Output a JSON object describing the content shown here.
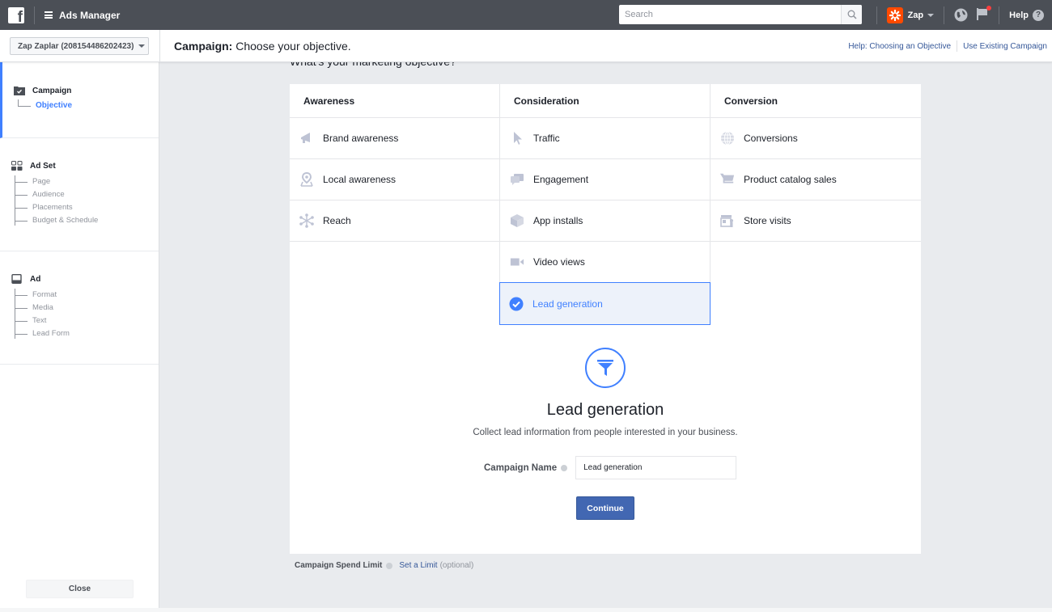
{
  "topbar": {
    "logo": "facebook-logo",
    "app_title": "Ads Manager",
    "search_placeholder": "Search",
    "search_value": "",
    "account_short": "Zap",
    "help_label": "Help",
    "help_glyph": "?",
    "notifications_badge_color": "#fa3e3e"
  },
  "subbar": {
    "account_selector": "Zap Zaplar (208154486202423)",
    "title_prefix": "Campaign:",
    "title_text": " Choose your objective.",
    "links": [
      "Help: Choosing an Objective",
      "Use Existing Campaign"
    ]
  },
  "sidebar": {
    "sections": [
      {
        "label": "Campaign",
        "icon": "folder-check-icon",
        "items": [
          {
            "label": "Objective",
            "active": true
          }
        ]
      },
      {
        "label": "Ad Set",
        "icon": "grid-icon",
        "items": [
          {
            "label": "Page"
          },
          {
            "label": "Audience"
          },
          {
            "label": "Placements"
          },
          {
            "label": "Budget & Schedule"
          }
        ]
      },
      {
        "label": "Ad",
        "icon": "ad-frame-icon",
        "items": [
          {
            "label": "Format"
          },
          {
            "label": "Media"
          },
          {
            "label": "Text"
          },
          {
            "label": "Lead Form"
          }
        ]
      }
    ],
    "close_label": "Close"
  },
  "main": {
    "heading": "What's your marketing objective?",
    "columns": [
      {
        "title": "Awareness",
        "items": [
          {
            "label": "Brand awareness",
            "icon": "megaphone-icon"
          },
          {
            "label": "Local awareness",
            "icon": "location-pin-icon"
          },
          {
            "label": "Reach",
            "icon": "reach-network-icon"
          }
        ]
      },
      {
        "title": "Consideration",
        "items": [
          {
            "label": "Traffic",
            "icon": "cursor-icon"
          },
          {
            "label": "Engagement",
            "icon": "chat-bubbles-icon"
          },
          {
            "label": "App installs",
            "icon": "box-icon"
          },
          {
            "label": "Video views",
            "icon": "video-camera-icon"
          },
          {
            "label": "Lead generation",
            "icon": "check-circle-icon",
            "selected": true
          }
        ]
      },
      {
        "title": "Conversion",
        "items": [
          {
            "label": "Conversions",
            "icon": "globe-icon"
          },
          {
            "label": "Product catalog sales",
            "icon": "shopping-cart-icon"
          },
          {
            "label": "Store visits",
            "icon": "store-icon"
          }
        ]
      }
    ],
    "detail": {
      "icon": "funnel-icon",
      "title": "Lead generation",
      "description": "Collect lead information from people interested in your business.",
      "campaign_name_label": "Campaign Name",
      "campaign_name_value": "Lead generation",
      "continue_label": "Continue"
    },
    "spend_limit": {
      "label": "Campaign Spend Limit",
      "link": "Set a Limit",
      "optional": "(optional)"
    }
  },
  "colors": {
    "topbar": "#4b4f56",
    "accent": "#4080ff",
    "primary_button": "#4267b2",
    "link": "#365899",
    "selected_bg": "#edf2fa",
    "zap_brand": "#ff4a00"
  }
}
